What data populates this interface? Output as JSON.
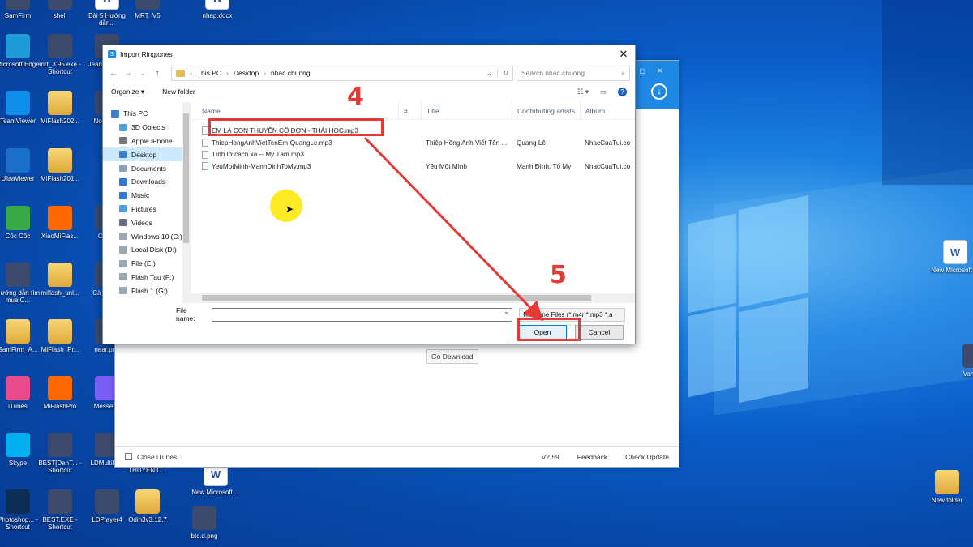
{
  "desktop": {
    "left_icons": [
      {
        "label": "SamFirm",
        "icon": "app-icon"
      },
      {
        "label": "shell",
        "icon": "app-icon"
      },
      {
        "label": "Bài 5 Hướng dẫn...",
        "icon": "doc-icon"
      },
      {
        "label": "MRT_V5",
        "icon": "app-icon"
      },
      {
        "label": "nhap.docx",
        "icon": "doc-icon"
      },
      {
        "label": "Microsoft Edge",
        "icon": "edge-icon"
      },
      {
        "label": "mrt_3.95.exe - Shortcut",
        "icon": "app-icon"
      },
      {
        "label": "Jeanso... Chi",
        "icon": "app-icon"
      },
      {
        "label": "TeamViewer",
        "icon": "teamviewer-icon"
      },
      {
        "label": "MiFlash202...",
        "icon": "folder-icon"
      },
      {
        "label": "Nok... Su",
        "icon": "app-icon"
      },
      {
        "label": "UltraViewer",
        "icon": "ultraviewer-icon"
      },
      {
        "label": "MiFlash201...",
        "icon": "folder-icon"
      },
      {
        "label": "Cốc Cốc",
        "icon": "coccoc-icon"
      },
      {
        "label": "XiaoMiFlas...",
        "icon": "mi-icon"
      },
      {
        "label": "Oc Sh",
        "icon": "app-icon"
      },
      {
        "label": "Hướng dẫn tìm mua C...",
        "icon": "app-icon"
      },
      {
        "label": "miflash_unl...",
        "icon": "folder-icon"
      },
      {
        "label": "Cà nh Chi",
        "icon": "app-icon"
      },
      {
        "label": "SamFirm_A...",
        "icon": "folder-icon"
      },
      {
        "label": "MiFlash_Pr...",
        "icon": "folder-icon"
      },
      {
        "label": "near.png",
        "icon": "app-icon"
      },
      {
        "label": "iTunes",
        "icon": "itunes-icon"
      },
      {
        "label": "MiFlashPro",
        "icon": "mi-icon"
      },
      {
        "label": "Messeng",
        "icon": "messenger-icon"
      },
      {
        "label": "Skype",
        "icon": "skype-icon"
      },
      {
        "label": "BEST[DanT... - Shortcut",
        "icon": "app-icon"
      },
      {
        "label": "LDMultiPl...",
        "icon": "app-icon"
      },
      {
        "label": "EM LÀ CON THUYỀN C...",
        "icon": "app-icon"
      },
      {
        "label": "New Microsoft ...",
        "icon": "doc-icon"
      },
      {
        "label": "Photoshop... - Shortcut",
        "icon": "photoshop-icon"
      },
      {
        "label": "BEST.EXE - Shortcut",
        "icon": "app-icon"
      },
      {
        "label": "LDPlayer4",
        "icon": "app-icon"
      },
      {
        "label": "Odin3v3.12.7",
        "icon": "folder-icon"
      },
      {
        "label": "btc.d.png",
        "icon": "app-icon"
      }
    ],
    "right_icons": [
      {
        "label": "New Microsoft ...",
        "icon": "doc-icon"
      },
      {
        "label": "Van (Co",
        "icon": "app-icon"
      },
      {
        "label": "New folder",
        "icon": "folder-icon"
      }
    ]
  },
  "app": {
    "go_download": "Go Download",
    "close_itunes": "Close iTunes",
    "version": "V2.59",
    "feedback": "Feedback",
    "check_update": "Check Update"
  },
  "dialog": {
    "title": "Import Ringtones",
    "address": [
      "This PC",
      "Desktop",
      "nhac chuong"
    ],
    "search_placeholder": "Search nhac chuong",
    "organize": "Organize ▾",
    "new_folder": "New folder",
    "nav": [
      {
        "label": "This PC",
        "icon": "pc-icon",
        "top": true,
        "selected": false
      },
      {
        "label": "3D Objects",
        "icon": "3d-objects-icon",
        "top": false,
        "selected": false
      },
      {
        "label": "Apple iPhone",
        "icon": "phone-icon",
        "top": false,
        "selected": false
      },
      {
        "label": "Desktop",
        "icon": "desktop-icon",
        "top": false,
        "selected": true
      },
      {
        "label": "Documents",
        "icon": "documents-icon",
        "top": false,
        "selected": false
      },
      {
        "label": "Downloads",
        "icon": "downloads-icon",
        "top": false,
        "selected": false
      },
      {
        "label": "Music",
        "icon": "music-icon",
        "top": false,
        "selected": false
      },
      {
        "label": "Pictures",
        "icon": "pictures-icon",
        "top": false,
        "selected": false
      },
      {
        "label": "Videos",
        "icon": "videos-icon",
        "top": false,
        "selected": false
      },
      {
        "label": "Windows 10 (C:)",
        "icon": "drive-icon",
        "top": false,
        "selected": false
      },
      {
        "label": "Local Disk (D:)",
        "icon": "drive-icon",
        "top": false,
        "selected": false
      },
      {
        "label": "File (E:)",
        "icon": "drive-icon",
        "top": false,
        "selected": false
      },
      {
        "label": "Flash Tau (F:)",
        "icon": "drive-icon",
        "top": false,
        "selected": false
      },
      {
        "label": "Flash 1 (G:)",
        "icon": "drive-icon",
        "top": false,
        "selected": false
      }
    ],
    "columns": {
      "name": "Name",
      "num": "#",
      "title": "Title",
      "artist": "Contributing artists",
      "album": "Album"
    },
    "files": [
      {
        "name": "EM LÀ CON THUYỀN CÔ ĐƠN - THÁI HỌC.mp3",
        "num": "",
        "title": "",
        "artist": "",
        "album": ""
      },
      {
        "name": "ThiepHongAnhVietTenEm-QuangLe.mp3",
        "num": "",
        "title": "Thiệp Hồng Anh Viết Tên ...",
        "artist": "Quang Lê",
        "album": "NhacCuaTui.co"
      },
      {
        "name": "Tình lỡ cách xa -- Mỹ Tâm.mp3",
        "num": "",
        "title": "",
        "artist": "",
        "album": ""
      },
      {
        "name": "YeuMotMinh-ManhDinhToMy.mp3",
        "num": "",
        "title": "Yêu Một Mình",
        "artist": "Mạnh Đình, Tố My",
        "album": "NhacCuaTui.co"
      }
    ],
    "file_name_label": "File name:",
    "file_name_value": "",
    "filter": "Ringtone Files (*.m4r *.mp3 *.a",
    "open": "Open",
    "cancel": "Cancel"
  },
  "annotations": {
    "step4": "4",
    "step5": "5",
    "accent": "#e53935"
  }
}
